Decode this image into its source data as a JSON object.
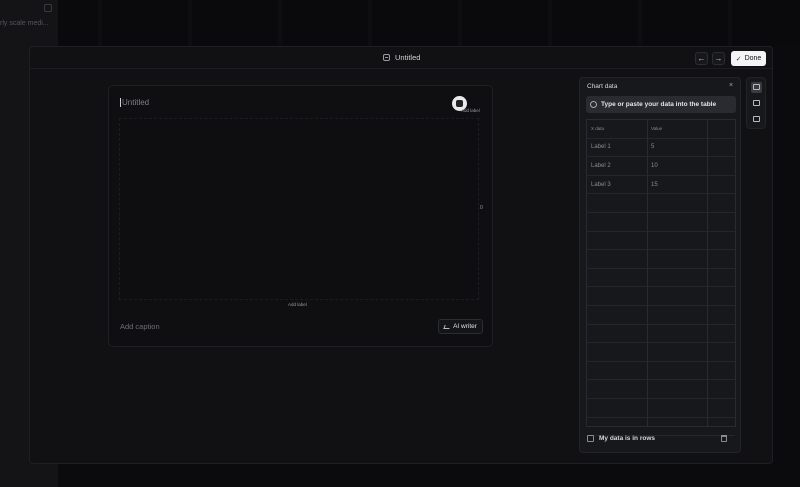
{
  "background": {
    "left_text": "rly scale medi..."
  },
  "header": {
    "title": "Untitled",
    "back_icon": "arrow-left-icon",
    "forward_icon": "arrow-right-icon",
    "done_label": "Done"
  },
  "chart_card": {
    "title": "Untitled",
    "add_label_top": "Add label",
    "y_tick": "0",
    "add_label_bottom": "Add label",
    "caption_placeholder": "Add caption",
    "ai_writer_label": "AI writer"
  },
  "panel": {
    "title": "Chart data",
    "close_glyph": "×",
    "hint": "Type or paste your data into the table",
    "columns": [
      "X data",
      "Value",
      ""
    ],
    "rows": [
      [
        "Label 1",
        "5",
        ""
      ],
      [
        "Label 2",
        "10",
        ""
      ],
      [
        "Label 3",
        "15",
        ""
      ]
    ],
    "empty_rows": 13,
    "rows_checkbox_label": "My data is in rows"
  },
  "colors": {
    "modal_bg": "#111114",
    "panel_bg": "#17181b",
    "done_bg": "#f4f4f6"
  }
}
